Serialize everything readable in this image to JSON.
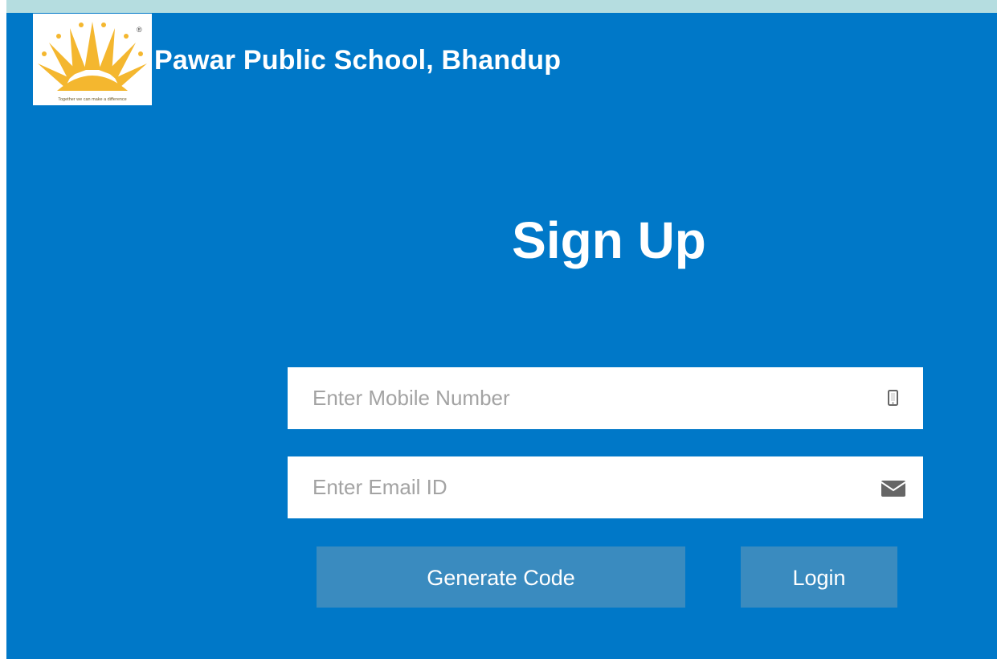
{
  "header": {
    "school_name": "Pawar Public School, Bhandup",
    "logo_icon": "sun-logo-icon",
    "logo_tagline": "Together we can make a difference",
    "logo_mark": "®"
  },
  "form": {
    "title": "Sign Up",
    "mobile": {
      "placeholder": "Enter Mobile Number",
      "value": "",
      "icon": "mobile-phone-icon"
    },
    "email": {
      "placeholder": "Enter Email ID",
      "value": "",
      "icon": "envelope-icon"
    },
    "generate_label": "Generate Code",
    "login_label": "Login"
  },
  "colors": {
    "background": "#0078c8",
    "top_strip": "#b5dde0",
    "button": "#3a8bbf",
    "logo_sun": "#f4b72f"
  }
}
